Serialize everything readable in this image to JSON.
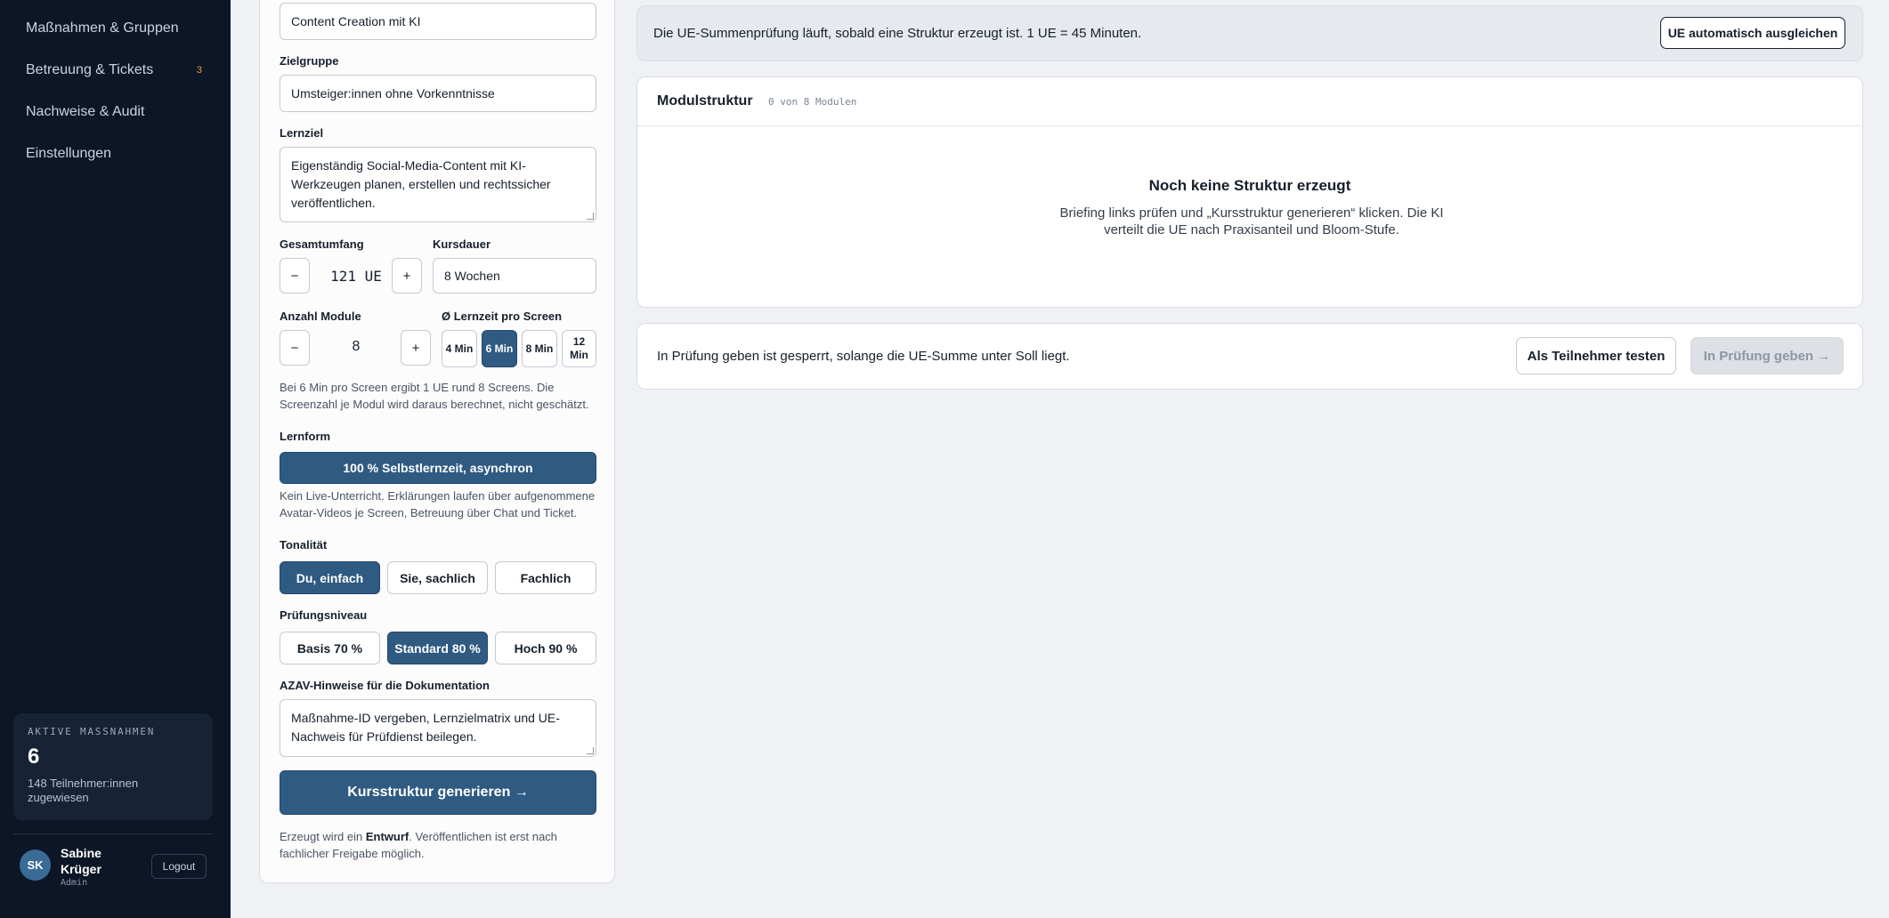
{
  "sidebar": {
    "nav": [
      {
        "label": "Maßnahmen & Gruppen",
        "badge": ""
      },
      {
        "label": "Betreuung & Tickets",
        "badge": "3"
      },
      {
        "label": "Nachweise & Audit",
        "badge": ""
      },
      {
        "label": "Einstellungen",
        "badge": ""
      }
    ],
    "stats": {
      "label": "AKTIVE MASSNAHMEN",
      "value": "6",
      "sub": "148 Teilnehmer:innen zugewiesen"
    },
    "user": {
      "initials": "SK",
      "name": "Sabine Krüger",
      "role": "Admin",
      "logout_label": "Logout"
    }
  },
  "form": {
    "title_value": "Content Creation mit KI",
    "target_label": "Zielgruppe",
    "target_value": "Umsteiger:innen ohne Vorkenntnisse",
    "goal_label": "Lernziel",
    "goal_value": "Eigenständig Social-Media-Content mit KI-Werkzeugen planen, erstellen und rechtssicher veröffentlichen.",
    "volume_label": "Gesamtumfang",
    "volume_minus": "−",
    "volume_value": "121 UE",
    "volume_plus": "+",
    "duration_label": "Kursdauer",
    "duration_value": "8 Wochen",
    "modules_label": "Anzahl Module",
    "modules_minus": "−",
    "modules_value": "8",
    "modules_plus": "+",
    "screen_time_label": "Ø Lernzeit pro Screen",
    "screen_time_options": [
      {
        "label": "4 Min",
        "active": false
      },
      {
        "label": "6 Min",
        "active": true
      },
      {
        "label": "8 Min",
        "active": false
      },
      {
        "label": "12 Min",
        "active": false
      }
    ],
    "screen_hint": "Bei 6 Min pro Screen ergibt 1 UE rund 8 Screens. Die Screenzahl je Modul wird daraus berechnet, nicht geschätzt.",
    "learnform_label": "Lernform",
    "learnform_value": "100 % Selbstlernzeit, asynchron",
    "learnform_hint": "Kein Live-Unterricht. Erklärungen laufen über aufgenommene Avatar-Videos je Screen, Betreuung über Chat und Ticket.",
    "tone_label": "Tonalität",
    "tone_options": [
      {
        "label": "Du, einfach",
        "active": true
      },
      {
        "label": "Sie, sachlich",
        "active": false
      },
      {
        "label": "Fachlich",
        "active": false
      }
    ],
    "exam_label": "Prüfungsniveau",
    "exam_options": [
      {
        "label": "Basis 70 %",
        "active": false
      },
      {
        "label": "Standard 80 %",
        "active": true
      },
      {
        "label": "Hoch 90 %",
        "active": false
      }
    ],
    "azav_label": "AZAV-Hinweise für die Dokumentation",
    "azav_value": "Maßnahme-ID vergeben, Lernzielmatrix und UE-Nachweis für Prüfdienst beilegen.",
    "generate_label": "Kursstruktur generieren →",
    "draft_note_pre": "Erzeugt wird ein ",
    "draft_note_bold": "Entwurf",
    "draft_note_post": ". Veröffentlichen ist erst nach fachlicher Freigabe möglich."
  },
  "main": {
    "info_text": "Die UE-Summenprüfung läuft, sobald eine Struktur erzeugt ist. 1 UE = 45 Minuten.",
    "balance_label": "UE automatisch ausgleichen",
    "structure_title": "Modulstruktur",
    "structure_count": "0 von 8 Modulen",
    "empty_title": "Noch keine Struktur erzeugt",
    "empty_text": "Briefing links prüfen und „Kursstruktur generieren“ klicken. Die KI verteilt die UE nach Praxisanteil und Bloom-Stufe.",
    "submit_text": "In Prüfung geben ist gesperrt, solange die UE-Summe unter Soll liegt.",
    "test_label": "Als Teilnehmer testen",
    "review_label": "In Prüfung geben →"
  }
}
